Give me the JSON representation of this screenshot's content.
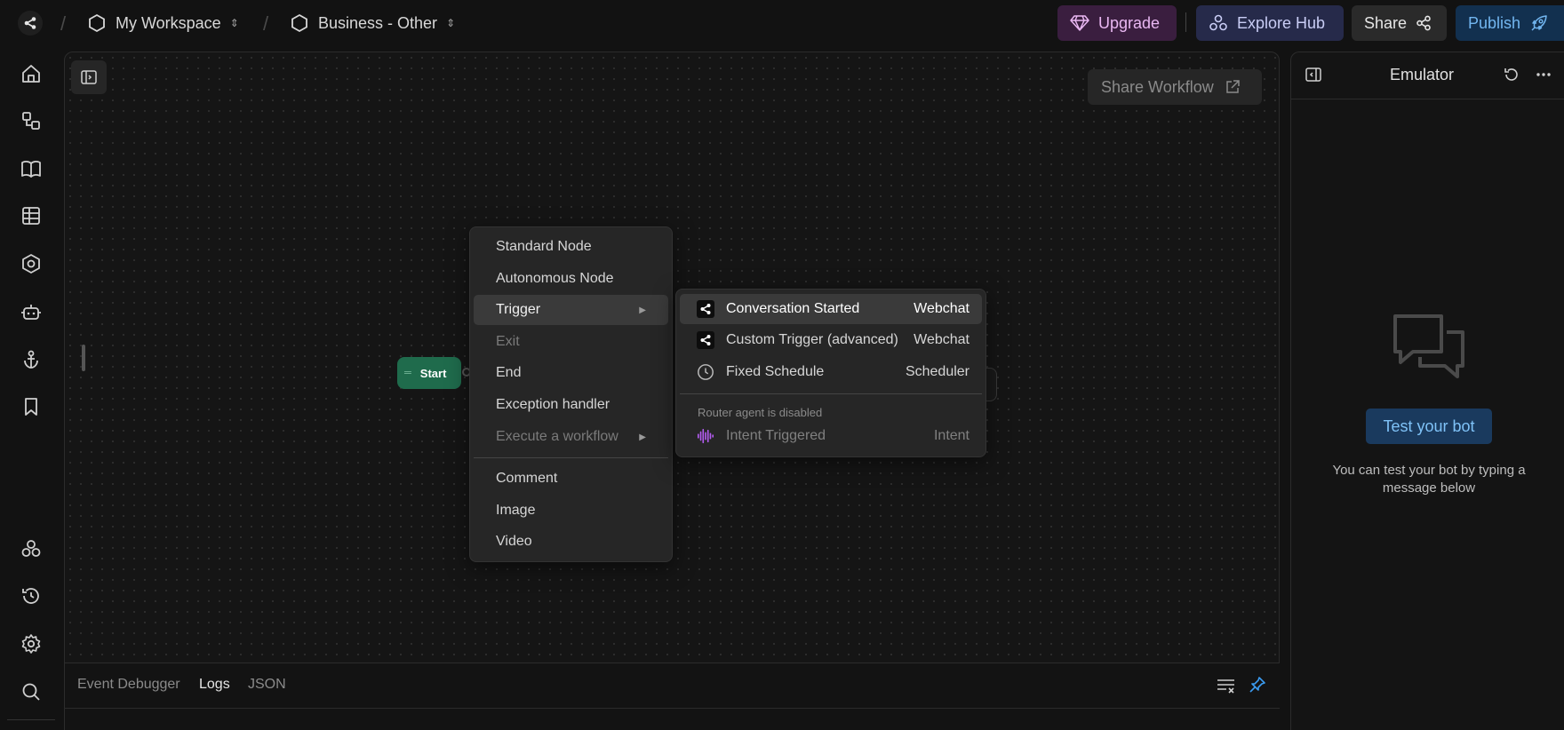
{
  "topbar": {
    "workspace": "My Workspace",
    "project": "Business - Other",
    "upgrade_label": "Upgrade",
    "explore_label": "Explore Hub",
    "share_label": "Share",
    "publish_label": "Publish"
  },
  "canvas": {
    "share_workflow_label": "Share Workflow",
    "start_node_label": "Start"
  },
  "context_menu": {
    "items": [
      {
        "label": "Standard Node"
      },
      {
        "label": "Autonomous Node"
      },
      {
        "label": "Trigger"
      },
      {
        "label": "Exit"
      },
      {
        "label": "End"
      },
      {
        "label": "Exception handler"
      },
      {
        "label": "Execute a workflow"
      },
      {
        "label": "Comment"
      },
      {
        "label": "Image"
      },
      {
        "label": "Video"
      }
    ]
  },
  "trigger_submenu": {
    "items": [
      {
        "label": "Conversation Started",
        "tag": "Webchat",
        "icon": "share-icon"
      },
      {
        "label": "Custom Trigger (advanced)",
        "tag": "Webchat",
        "icon": "share-icon"
      },
      {
        "label": "Fixed Schedule",
        "tag": "Scheduler",
        "icon": "clock-icon"
      }
    ],
    "disabled_note": "Router agent is disabled",
    "disabled_item": {
      "label": "Intent Triggered",
      "tag": "Intent",
      "icon": "waveform-icon"
    }
  },
  "emulator": {
    "title": "Emulator",
    "test_button": "Test your bot",
    "hint": "You can test your bot by typing a message below"
  },
  "debugger": {
    "tabs": [
      "Event Debugger",
      "Logs",
      "JSON"
    ],
    "active_tab": "Logs"
  },
  "colors": {
    "background": "#121212",
    "start_node": "#1f6b4c",
    "upgrade_bg": "#3a1e3f",
    "explore_bg": "#262a4a",
    "publish_bg": "#12304f",
    "test_button_bg": "#1a3a5e",
    "intent_icon": "#b35cf0"
  }
}
